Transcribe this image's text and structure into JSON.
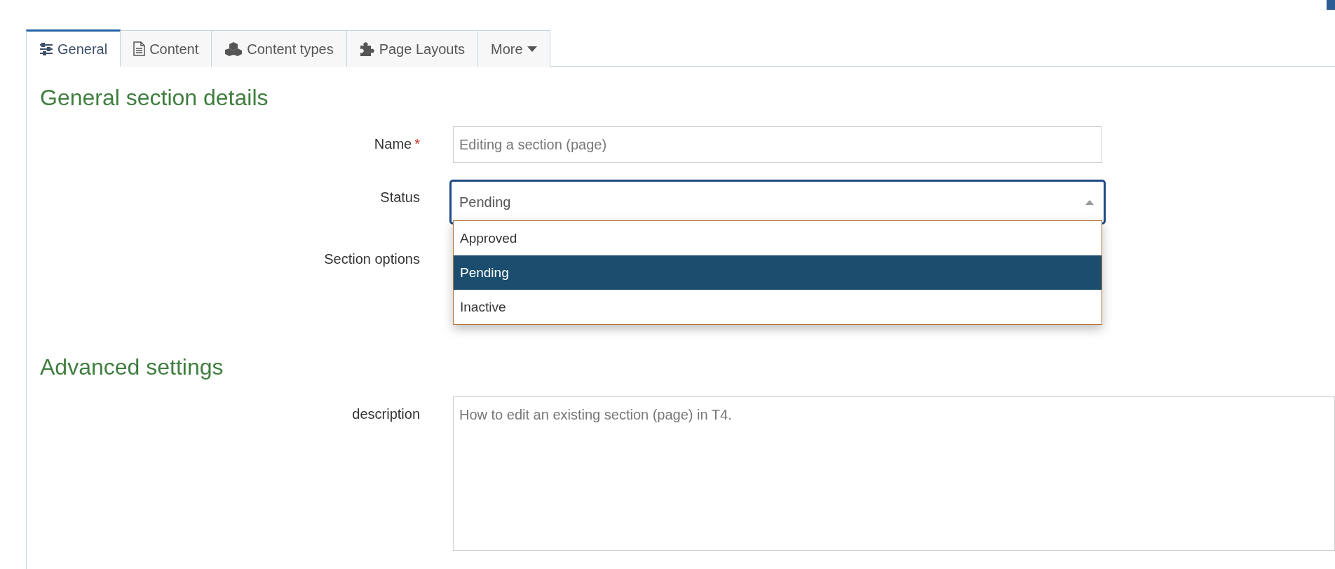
{
  "tabs": [
    {
      "label": "General",
      "selected": true
    },
    {
      "label": "Content",
      "selected": false
    },
    {
      "label": "Content types",
      "selected": false
    },
    {
      "label": "Page Layouts",
      "selected": false
    },
    {
      "label": "More",
      "selected": false
    }
  ],
  "sections": [
    {
      "title": "General section details",
      "fields": [
        {
          "label": "Name",
          "required_mark": "*",
          "kind": "text",
          "value": "Editing a section (page)"
        },
        {
          "label": "Status",
          "kind": "select",
          "value": "Pending",
          "expanded": true,
          "options": [
            {
              "label": "Approved",
              "selected": false
            },
            {
              "label": "Pending",
              "selected": true
            },
            {
              "label": "Inactive",
              "selected": false
            }
          ]
        },
        {
          "label": "Section options",
          "kind": "options"
        }
      ]
    },
    {
      "title": "Advanced settings",
      "fields": [
        {
          "label": "description",
          "kind": "textarea",
          "value": "How to edit an existing section (page) in T4."
        }
      ]
    }
  ]
}
